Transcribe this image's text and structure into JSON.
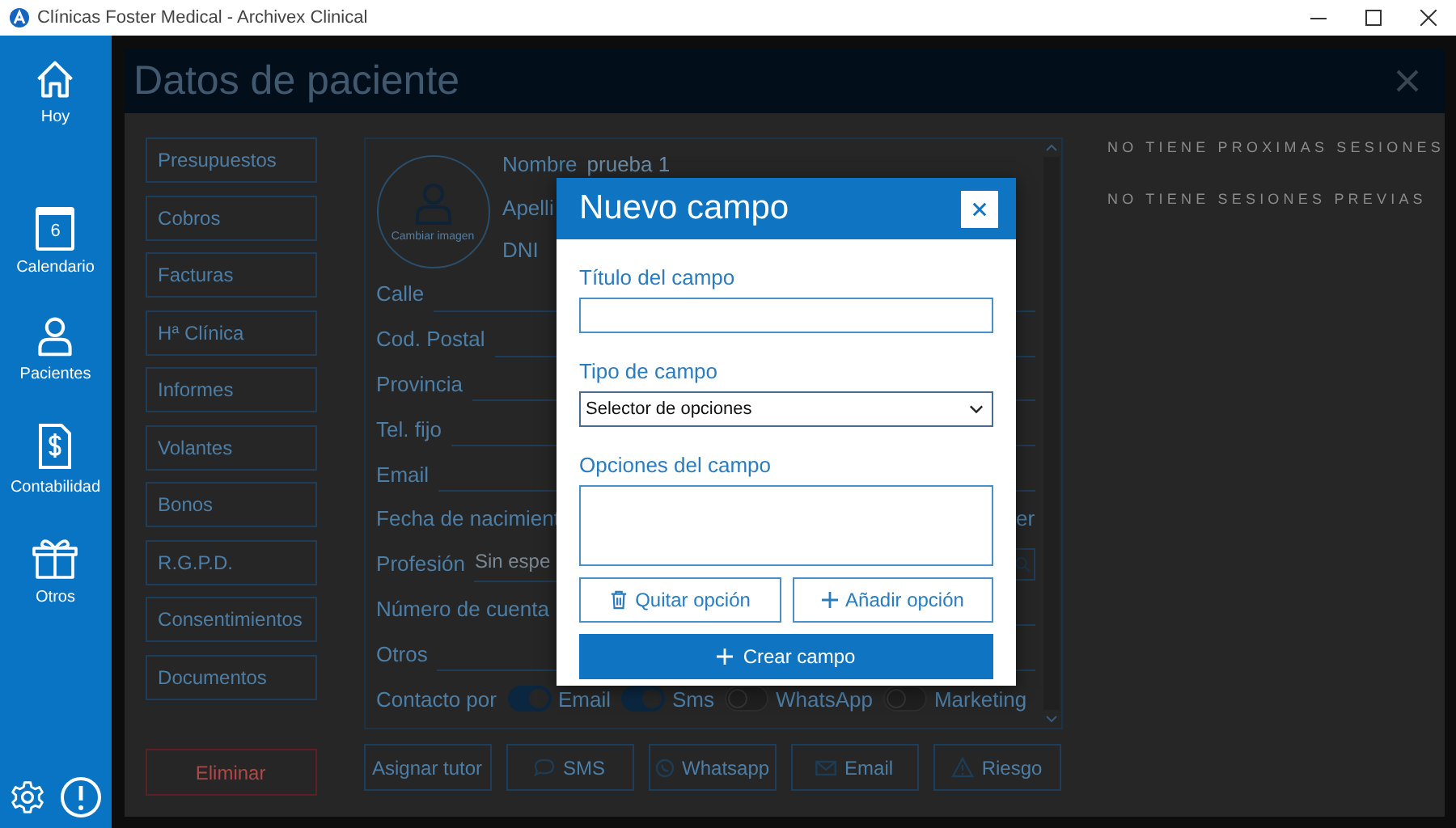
{
  "window": {
    "title": "Clínicas Foster Medical - Archivex Clinical"
  },
  "sidebar": {
    "items": [
      {
        "label": "Hoy",
        "kind": "home"
      },
      {
        "label": "Calendario",
        "kind": "calendar",
        "badge": "6"
      },
      {
        "label": "Pacientes",
        "kind": "person"
      },
      {
        "label": "Contabilidad",
        "kind": "ledger"
      },
      {
        "label": "Otros",
        "kind": "gift"
      }
    ]
  },
  "page": {
    "title": "Datos de paciente"
  },
  "sections": [
    "Presupuestos",
    "Cobros",
    "Facturas",
    "Hª Clínica",
    "Informes",
    "Volantes",
    "Bonos",
    "R.G.P.D.",
    "Consentimientos",
    "Documentos"
  ],
  "delete_button": "Eliminar",
  "patient": {
    "photo_caption": "Cambiar imagen",
    "identity": [
      {
        "label": "Nombre",
        "value": "prueba 1"
      },
      {
        "label": "Apelli"
      },
      {
        "label": "DNI"
      }
    ],
    "fields": [
      {
        "label": "Calle",
        "kind": "line"
      },
      {
        "label": "Cod. Postal",
        "kind": "line"
      },
      {
        "label": "Provincia",
        "kind": "line"
      },
      {
        "label": "Tel. fijo",
        "kind": "line"
      },
      {
        "label": "Email",
        "kind": "line"
      },
      {
        "label": "Fecha de nacimient",
        "kind": "line",
        "trailing": "er"
      },
      {
        "label": "Profesión",
        "kind": "search",
        "placeholder": "Sin espe"
      },
      {
        "label": "Número de cuenta",
        "kind": "line"
      },
      {
        "label": "Otros",
        "kind": "line"
      }
    ],
    "contact": {
      "label": "Contacto por",
      "options": [
        {
          "label": "Email",
          "on": true
        },
        {
          "label": "Sms",
          "on": true
        },
        {
          "label": "WhatsApp",
          "on": false
        },
        {
          "label": "Marketing",
          "on": false
        }
      ]
    }
  },
  "actions": [
    {
      "label": "Asignar tutor",
      "kind": "plain"
    },
    {
      "label": "SMS",
      "kind": "chat"
    },
    {
      "label": "Whatsapp",
      "kind": "whatsapp"
    },
    {
      "label": "Email",
      "kind": "mail"
    },
    {
      "label": "Riesgo",
      "kind": "warning"
    }
  ],
  "sessions": {
    "upcoming": "NO TIENE PROXIMAS SESIONES",
    "previous": "NO TIENE SESIONES PREVIAS"
  },
  "dialog": {
    "title": "Nuevo campo",
    "fields": [
      {
        "label": "Título del campo",
        "kind": "text"
      },
      {
        "label": "Tipo de campo",
        "kind": "select",
        "value": "Selector de opciones"
      },
      {
        "label": "Opciones del campo",
        "kind": "list"
      }
    ],
    "buttons": [
      {
        "label": "Quitar opción",
        "kind": "remove"
      },
      {
        "label": "Añadir opción",
        "kind": "add"
      }
    ],
    "submit": "Crear campo"
  }
}
